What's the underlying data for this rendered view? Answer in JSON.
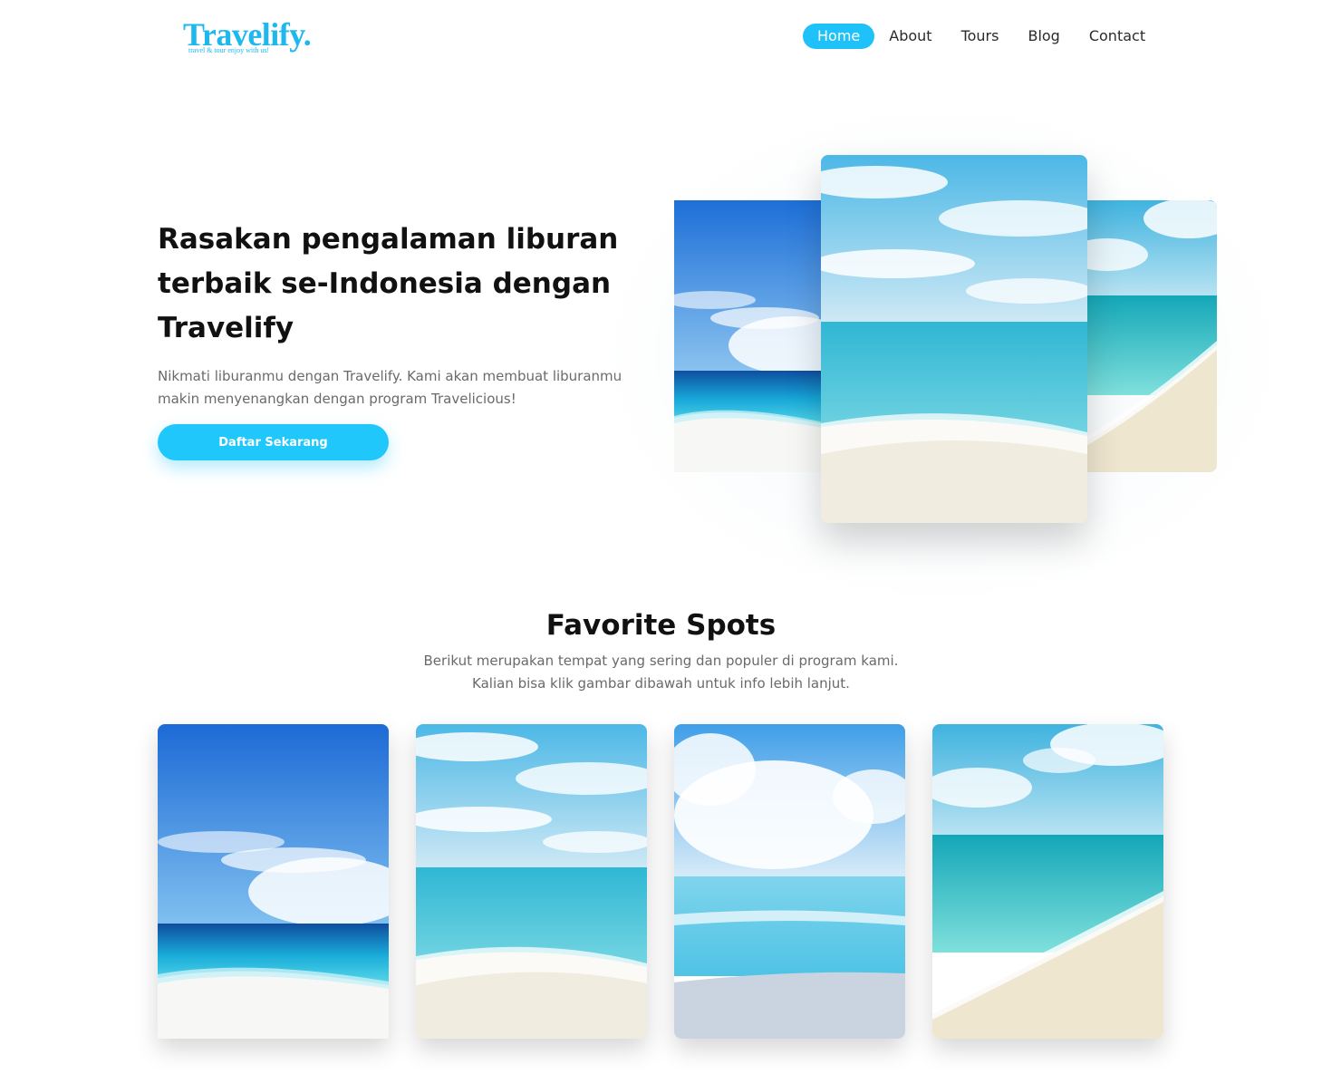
{
  "header": {
    "logo": {
      "name": "Travelify.",
      "tagline": "travel & tour enjoy with us!"
    },
    "nav": [
      {
        "label": "Home",
        "active": true
      },
      {
        "label": "About",
        "active": false
      },
      {
        "label": "Tours",
        "active": false
      },
      {
        "label": "Blog",
        "active": false
      },
      {
        "label": "Contact",
        "active": false
      }
    ]
  },
  "hero": {
    "title": "Rasakan pengalaman liburan terbaik se-Indonesia dengan Travelify",
    "subtitle": "Nikmati liburanmu dengan Travelify. Kami akan membuat liburanmu makin menyenangkan dengan program Travelicious!",
    "cta_label": "Daftar Sekarang",
    "images": [
      "beach-photo-left",
      "beach-photo-center",
      "beach-photo-right"
    ]
  },
  "favorites": {
    "title": "Favorite Spots",
    "description": "Berikut merupakan tempat yang sering dan populer di program kami. Kalian bisa klik gambar dibawah untuk info lebih lanjut.",
    "spots": [
      "beach-photo-1",
      "beach-photo-2",
      "beach-photo-3",
      "beach-photo-4"
    ]
  },
  "colors": {
    "accent": "#1fc2f8",
    "brand": "#1fb8ee",
    "text": "#111111",
    "muted": "#6a6a6a"
  }
}
